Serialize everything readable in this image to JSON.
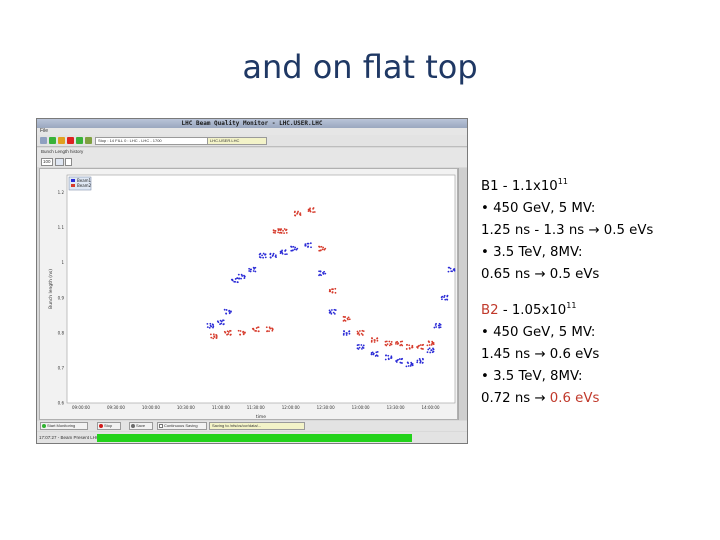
{
  "slide": {
    "title": "and on flat top"
  },
  "app": {
    "window_title": "LHC Beam Quality Monitor - LHC.USER.LHC",
    "menu_label": "File",
    "toolbar_field": "Stop : 14 FILL 0 : LHC - LHC - 1700",
    "toolbar_field2": "LHC.USER.LHC",
    "subbar_label": "Bunch Length history",
    "ctrl_value": "100",
    "legend": [
      {
        "label": "Beam1",
        "color": "#2b2bd6"
      },
      {
        "label": "Beam2",
        "color": "#d63a2b"
      }
    ],
    "bottom_buttons": [
      {
        "label": "Start Monitoring",
        "dot_color": "#2fb32f"
      },
      {
        "label": "Stop",
        "dot_color": "#d21a1a"
      },
      {
        "label": "Save",
        "dot_color": "#6b6b6b"
      },
      {
        "label": "Continuous Saving",
        "dot_color": "#ffffff"
      }
    ],
    "bottom_field": "Saving to /nfs/cs/ccr/data/...",
    "status_text": "17:07:27 - Beam Present LHC",
    "status_color": "#22d21a"
  },
  "chart_data": {
    "type": "scatter",
    "title": "",
    "xlabel": "time",
    "ylabel": "Bunch length (ns)",
    "x_ticks": [
      "09:00:00",
      "09:30:00",
      "10:00:00",
      "10:30:00",
      "11:00:00",
      "11:30:00",
      "12:00:00",
      "12:30:00",
      "13:00:00",
      "13:30:00",
      "14:00:00"
    ],
    "y_ticks": [
      1.2,
      1.1,
      1.0,
      0.9,
      0.8,
      0.7,
      0.6
    ],
    "ylim": [
      0.6,
      1.25
    ],
    "legend_position": "top-left",
    "grid": false,
    "series": [
      {
        "name": "Beam1",
        "color": "#2b2bd6",
        "x": [
          10.85,
          11.0,
          11.1,
          11.2,
          11.3,
          11.45,
          11.6,
          11.75,
          11.9,
          12.05,
          12.25,
          12.45,
          12.6,
          12.8,
          13.0,
          13.2,
          13.4,
          13.55,
          13.7,
          13.85,
          14.0,
          14.1,
          14.2,
          14.3
        ],
        "y": [
          0.82,
          0.83,
          0.86,
          0.95,
          0.96,
          0.98,
          1.02,
          1.02,
          1.03,
          1.04,
          1.05,
          0.97,
          0.86,
          0.8,
          0.76,
          0.74,
          0.73,
          0.72,
          0.71,
          0.72,
          0.75,
          0.82,
          0.9,
          0.98
        ]
      },
      {
        "name": "Beam2",
        "color": "#d63a2b",
        "x": [
          10.9,
          11.1,
          11.3,
          11.5,
          11.7,
          11.8,
          11.9,
          12.1,
          12.3,
          12.45,
          12.6,
          12.8,
          13.0,
          13.2,
          13.4,
          13.55,
          13.7,
          13.85,
          14.0
        ],
        "y": [
          0.79,
          0.8,
          0.8,
          0.81,
          0.81,
          1.09,
          1.09,
          1.14,
          1.15,
          1.04,
          0.92,
          0.84,
          0.8,
          0.78,
          0.77,
          0.77,
          0.76,
          0.76,
          0.77
        ]
      }
    ]
  },
  "info": {
    "b1_title_pre": "B1 - 1.1x10",
    "b1_exp": "11",
    "b1_line1": "• 450 GeV, 5 MV:",
    "b1_line2": "1.25 ns - 1.3 ns → 0.5 eVs",
    "b1_line3": "• 3.5 TeV, 8MV:",
    "b1_line4": "0.65 ns → 0.5 eVs",
    "b2_label": "B2",
    "b2_title_rest": " - 1.05x10",
    "b2_exp": "11",
    "b2_line1": "• 450 GeV, 5 MV:",
    "b2_line2": "1.45 ns → 0.6 eVs",
    "b2_line3": "• 3.5 TeV, 8MV:",
    "b2_line4_pre": "0.72 ns → ",
    "b2_line4_red": "0.6 eVs"
  }
}
